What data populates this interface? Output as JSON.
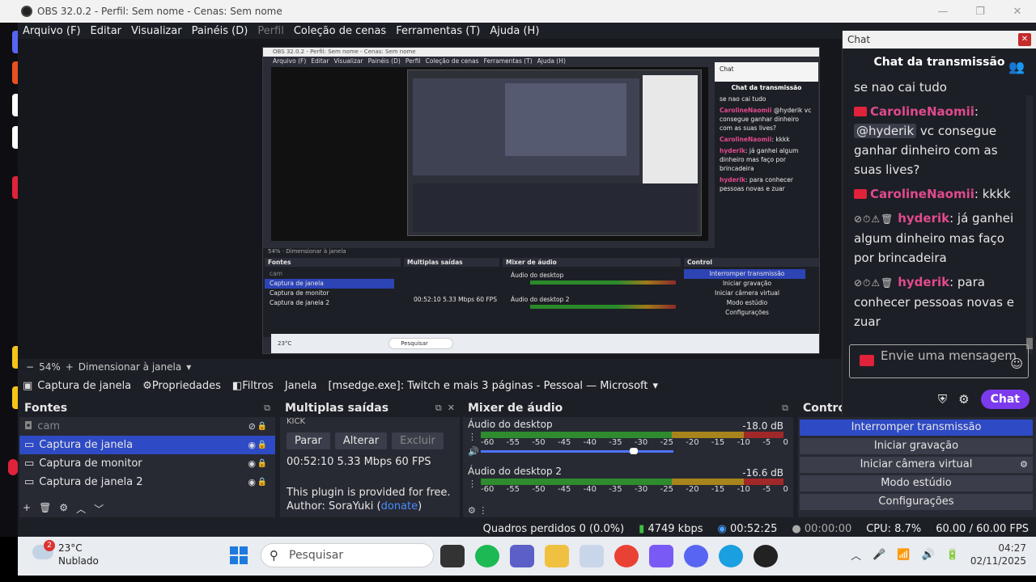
{
  "window": {
    "title": "OBS 32.0.2 - Perfil: Sem nome - Cenas: Sem nome"
  },
  "menu": [
    "Arquivo (F)",
    "Editar",
    "Visualizar",
    "Painéis (D)",
    "Perfil",
    "Coleção de cenas",
    "Ferramentas (T)",
    "Ajuda (H)"
  ],
  "zoom": {
    "percent": "54%",
    "mode": "Dimensionar à janela"
  },
  "source_toolbar": {
    "source": "Captura de janela",
    "properties": "Propriedades",
    "filters": "Filtros",
    "window_label": "Janela",
    "window_value": "[msedge.exe]: Twitch e mais 3 páginas - Pessoal — Microsoft"
  },
  "sources": {
    "title": "Fontes",
    "items": [
      {
        "name": "cam",
        "hidden": true
      },
      {
        "name": "Captura de janela",
        "selected": true
      },
      {
        "name": "Captura de monitor"
      },
      {
        "name": "Captura de janela 2"
      }
    ]
  },
  "outputs": {
    "title": "Multiplas saídas",
    "platform": "KICK",
    "buttons": [
      "Parar",
      "Alterar",
      "Excluir"
    ],
    "stats": "00:52:10  5.33 Mbps  60 FPS",
    "plugin_text": "This plugin is provided for free.",
    "author_prefix": "Author: SoraYuki (",
    "author_link": "donate",
    "author_suffix": ")"
  },
  "mixer": {
    "title": "Mixer de áudio",
    "channels": [
      {
        "name": "Áudio do desktop",
        "db": "-18.0 dB"
      },
      {
        "name": "Áudio do desktop 2",
        "db": "-16.6 dB"
      }
    ],
    "scale": [
      "-60",
      "-55",
      "-50",
      "-45",
      "-40",
      "-35",
      "-30",
      "-25",
      "-20",
      "-15",
      "-10",
      "-5",
      "0"
    ]
  },
  "controls": {
    "title": "Control",
    "buttons": [
      "Interromper transmissão",
      "Iniciar gravação",
      "Iniciar câmera virtual",
      "Modo estúdio",
      "Configurações"
    ]
  },
  "status": {
    "dropped": "Quadros perdidos 0 (0.0%)",
    "bitrate": "4749 kbps",
    "stream_time": "00:52:25",
    "rec_time": "00:00:00",
    "cpu": "CPU: 8.7%",
    "fps": "60.00 / 60.00 FPS"
  },
  "chat": {
    "window_title": "Chat",
    "header": "Chat da transmissão",
    "messages": [
      {
        "text": "se nao cai tudo"
      },
      {
        "nick": "CarolineNaomii",
        "mention": "@hyderik",
        "text": " vc consegue ganhar dinheiro com as suas lives?"
      },
      {
        "nick": "CarolineNaomii",
        "text": ": kkkk"
      },
      {
        "nick": "hyderik",
        "text": ": já ganhei algum dinheiro mas faço por brincadeira"
      },
      {
        "nick": "hyderik",
        "text": ": para conhecer pessoas novas e zuar"
      }
    ],
    "input_placeholder": "Envie uma mensagem",
    "send": "Chat"
  },
  "taskbar": {
    "temp": "23°C",
    "weather": "Nublado",
    "weather_badge": "2",
    "search": "Pesquisar",
    "time": "04:27",
    "date": "02/11/2025"
  },
  "colors": {
    "accent": "#2e4ac4",
    "chat_nick": "#e04a8c",
    "send_button": "#7c3aed",
    "live_red": "#e0223a"
  }
}
